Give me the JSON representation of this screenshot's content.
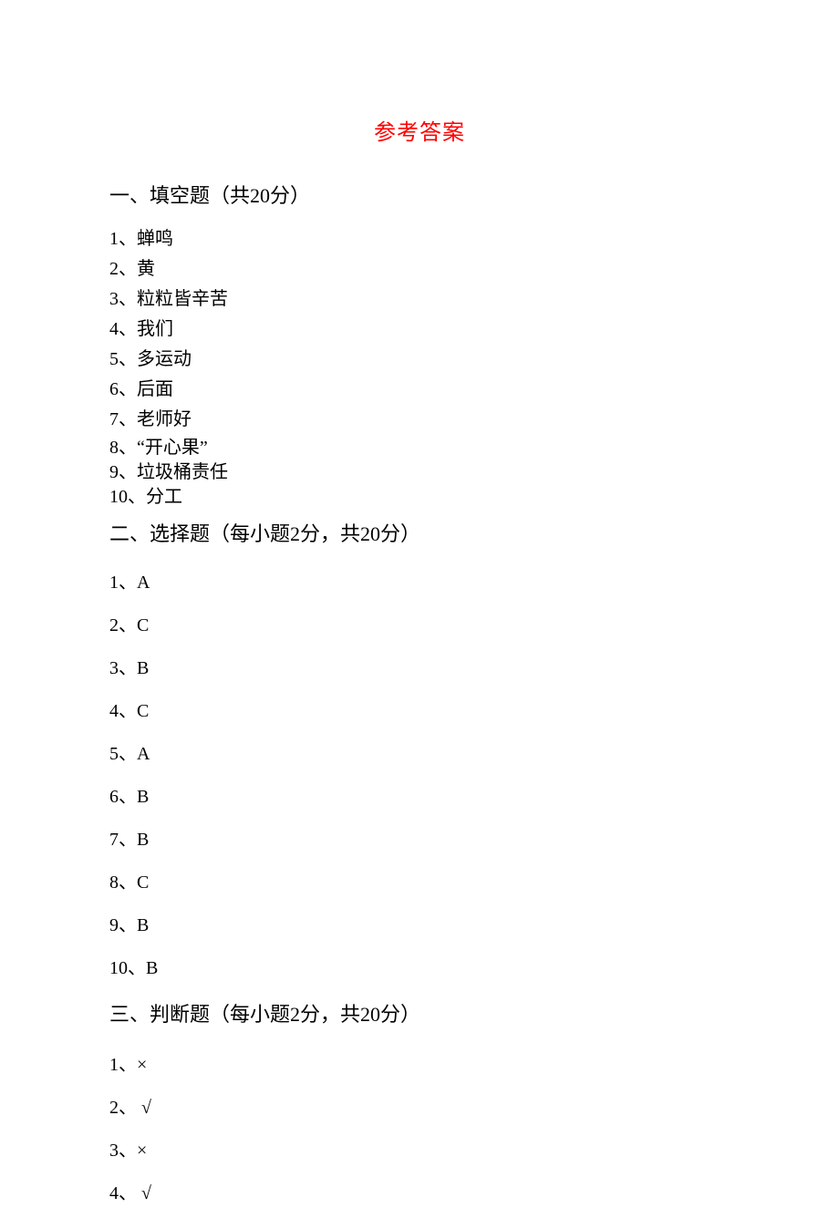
{
  "title": "参考答案",
  "sections": {
    "s1": {
      "heading": "一、填空题（共20分）",
      "items": [
        "1、蝉鸣",
        "2、黄",
        "3、粒粒皆辛苦",
        "4、我们",
        "5、多运动",
        "6、后面",
        "7、老师好",
        "8、“开心果”",
        "9、垃圾桶责任",
        "10、分工"
      ]
    },
    "s2": {
      "heading": "二、选择题（每小题2分，共20分）",
      "items": [
        "1、A",
        "2、C",
        "3、B",
        "4、C",
        "5、A",
        "6、B",
        "7、B",
        "8、C",
        "9、B",
        "10、B"
      ]
    },
    "s3": {
      "heading": "三、判断题（每小题2分，共20分）",
      "items": [
        "1、×",
        "2、 √",
        "3、×",
        "4、 √"
      ]
    }
  }
}
